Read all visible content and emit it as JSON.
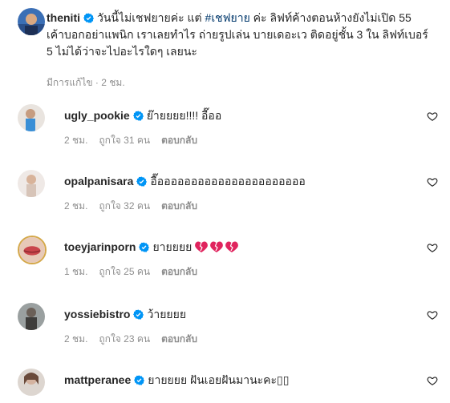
{
  "post": {
    "username": "theniti",
    "caption_part1": "วันนี้ไม่เชฟยายค่ะ แต่ ",
    "hashtag": "#เชฟยาย",
    "caption_part2": " ค่ะ ลิฟท์ค้างตอนห้างยังไม่เปิด 55 เค้าบอกอย่าแพนิก เราเลยทำไร ถ่ายรูปเล่น บายเดอะเว ติดอยู่ชั้น 3 ใน ลิฟท์เบอร์ 5 ไม่ได้ว่าจะไปอะไรใดๆ เลยนะ",
    "meta": "มีการแก้ไข · 2 ชม."
  },
  "comments": [
    {
      "username": "ugly_pookie",
      "text": "ย๊ายยยย!!!! อื๊ออ",
      "time": "2 ชม.",
      "likes": "ถูกใจ 31 คน",
      "reply": "ตอบกลับ"
    },
    {
      "username": "opalpanisara",
      "text": "อื๊ออออออออออออออออออออออ",
      "time": "2 ชม.",
      "likes": "ถูกใจ 32 คน",
      "reply": "ตอบกลับ"
    },
    {
      "username": "toeyjarinporn",
      "text": "ยายยยย",
      "time": "1 ชม.",
      "likes": "ถูกใจ 25 คน",
      "reply": "ตอบกลับ"
    },
    {
      "username": "yossiebistro",
      "text": "ว้ายยยย",
      "time": "2 ชม.",
      "likes": "ถูกใจ 23 คน",
      "reply": "ตอบกลับ"
    },
    {
      "username": "mattperanee",
      "text": "ยายยยย ฝันเอยฝันมานะคะ▯▯",
      "time": "",
      "likes": "",
      "reply": ""
    }
  ],
  "colors": {
    "verified": "#0095f6",
    "meta": "#8e8e8e",
    "hashtag": "#00376b",
    "heart_emoji": "#e0245e"
  }
}
